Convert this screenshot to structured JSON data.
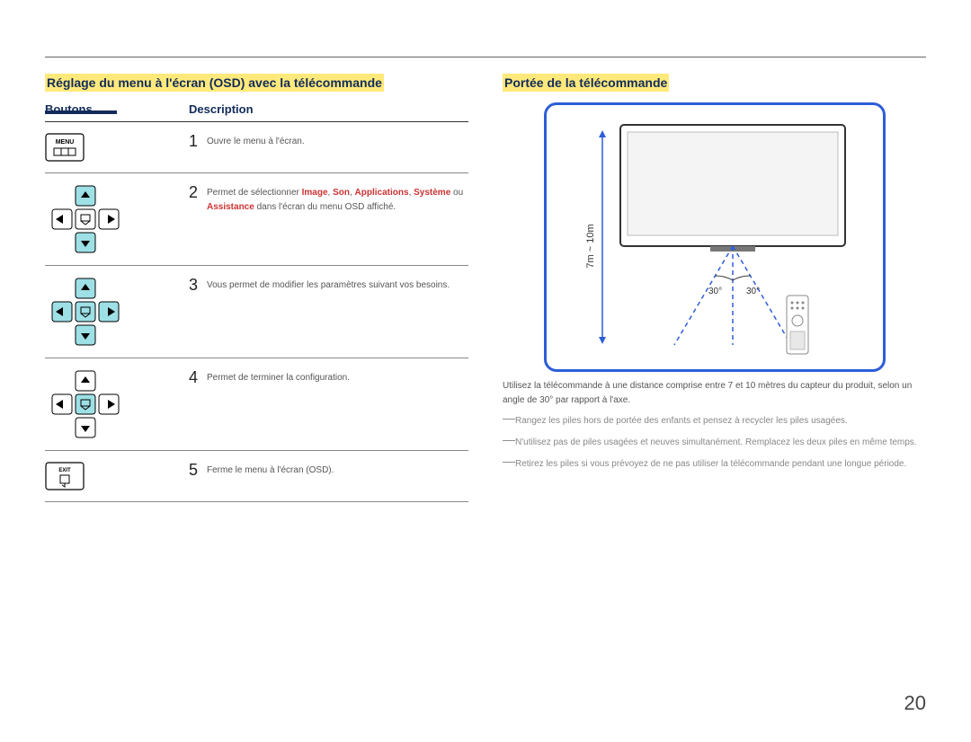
{
  "page_number": "20",
  "left": {
    "heading": "Réglage du menu à l'écran (OSD) avec la télécommande",
    "col_buttons": "Boutons",
    "col_desc": "Description",
    "rows": [
      {
        "num": "1",
        "desc_plain": "Ouvre le menu à l'écran.",
        "btn_label": "MENU"
      },
      {
        "num": "2",
        "desc_pre": "Permet de sélectionner ",
        "kw1": "Image",
        "kw2": "Son",
        "kw3": "Applications",
        "kw4": "Système",
        "or": " ou ",
        "kw5": "Assistance",
        "desc_post": " dans l'écran du menu OSD affiché."
      },
      {
        "num": "3",
        "desc_plain": "Vous permet de modifier les paramètres suivant vos besoins."
      },
      {
        "num": "4",
        "desc_plain": "Permet de terminer la configuration."
      },
      {
        "num": "5",
        "desc_plain": "Ferme le menu à l'écran (OSD).",
        "btn_label": "EXIT"
      }
    ]
  },
  "right": {
    "heading": "Portée de la télécommande",
    "range_label": "7m ~ 10m",
    "angle_left": "30°",
    "angle_right": "30°",
    "paragraph": "Utilisez la télécommande à une distance comprise entre 7 et 10 mètres du capteur du produit, selon un angle de 30° par rapport à l'axe.",
    "notes": [
      "Rangez les piles hors de portée des enfants et pensez à recycler les piles usagées.",
      "N'utilisez pas de piles usagées et neuves simultanément. Remplacez les deux piles en même temps.",
      "Retirez les piles si vous prévoyez de ne pas utiliser la télécommande pendant une longue période."
    ]
  }
}
